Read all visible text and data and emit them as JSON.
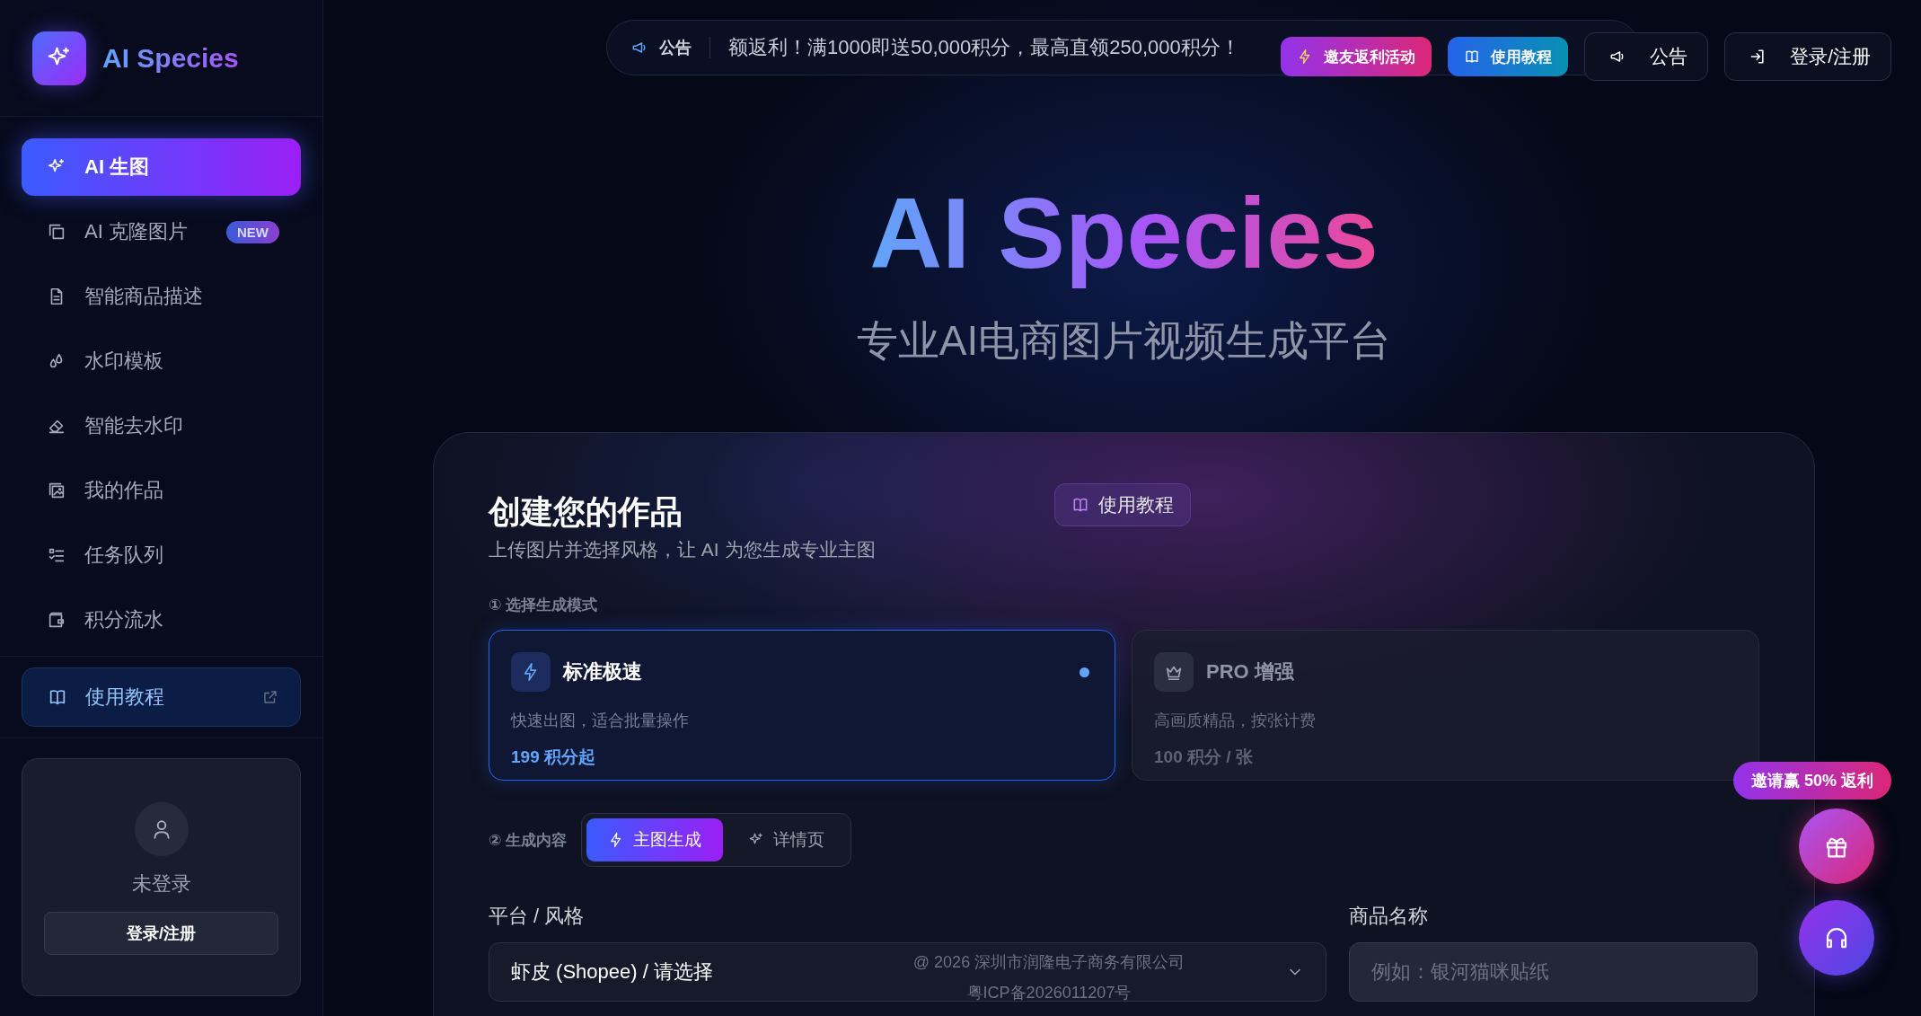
{
  "brand": {
    "name": "AI Species"
  },
  "nav": [
    {
      "label": "AI 生图",
      "selected": true
    },
    {
      "label": "AI 克隆图片",
      "selected": false,
      "badge": "NEW"
    },
    {
      "label": "智能商品描述",
      "selected": false
    },
    {
      "label": "水印模板",
      "selected": false
    },
    {
      "label": "智能去水印",
      "selected": false
    },
    {
      "label": "我的作品",
      "selected": false
    },
    {
      "label": "任务队列",
      "selected": false
    },
    {
      "label": "积分流水",
      "selected": false
    }
  ],
  "sidebar_link": {
    "label": "使用教程"
  },
  "user": {
    "status": "未登录",
    "button": "登录/注册"
  },
  "announcement": {
    "label": "公告",
    "text": "额返利！满1000即送50,000积分，最高直领250,000积分！"
  },
  "top_buttons": [
    {
      "label": "邀友返利活动",
      "kind": "promo"
    },
    {
      "label": "使用教程",
      "kind": "tutorial"
    },
    {
      "label": "公告",
      "kind": "notice"
    },
    {
      "label": "登录/注册",
      "kind": "login"
    }
  ],
  "hero": {
    "title": "AI Species",
    "subtitle": "专业AI电商图片视频生成平台"
  },
  "form": {
    "title": "创建您的作品",
    "subtitle": "上传图片并选择风格，让 AI 为您生成专业主图",
    "tutorial": "使用教程",
    "step1": "① 选择生成模式",
    "step2": "② 生成内容"
  },
  "modes": [
    {
      "name": "标准极速",
      "desc": "快速出图，适合批量操作",
      "price": "199 积分起",
      "selected": true
    },
    {
      "name": "PRO 增强",
      "desc": "高画质精品，按张计费",
      "price": "100 积分 / 张",
      "selected": false
    }
  ],
  "content_tabs": [
    {
      "label": "主图生成",
      "selected": true
    },
    {
      "label": "详情页",
      "selected": false
    }
  ],
  "fields": {
    "platform_label": "平台 / 风格",
    "platform_value": "虾皮 (Shopee) / 请选择",
    "name_label": "商品名称",
    "name_placeholder": "例如：银河猫咪贴纸"
  },
  "footer": {
    "copyright": "@ 2026 深圳市润隆电子商务有限公司",
    "icp": "粤ICP备2026011207号"
  },
  "floating": {
    "invite": "邀请赢 50% 返利"
  }
}
